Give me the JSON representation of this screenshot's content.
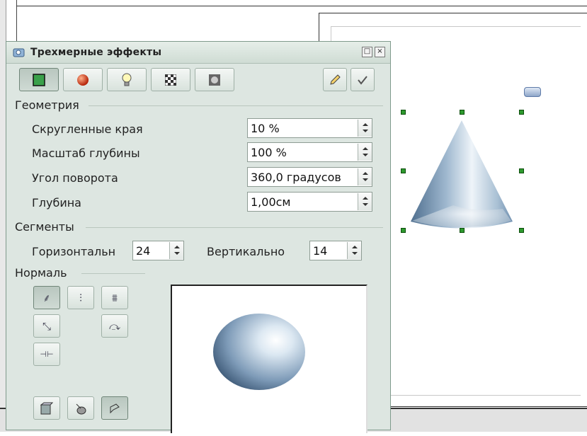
{
  "dialog": {
    "title": "Трехмерные эффекты",
    "title_icon": "3d-effects-icon",
    "controls": {
      "restore": "□",
      "close": "×"
    }
  },
  "toolbar": {
    "tools": [
      {
        "name": "geometry",
        "icon": "geometry-icon",
        "pressed": true
      },
      {
        "name": "shading",
        "icon": "shading-icon",
        "pressed": false
      },
      {
        "name": "illumination",
        "icon": "lightbulb-icon",
        "pressed": false
      },
      {
        "name": "textures",
        "icon": "texture-icon",
        "pressed": false
      },
      {
        "name": "material",
        "icon": "material-icon",
        "pressed": false
      }
    ],
    "right": [
      {
        "name": "assign",
        "icon": "pencil-icon",
        "pressed": true
      },
      {
        "name": "update",
        "icon": "checkmark-icon",
        "pressed": false
      }
    ]
  },
  "geometry": {
    "section_label": "Геометрия",
    "fields": [
      {
        "label": "Скругленные края",
        "value": "10 %"
      },
      {
        "label": "Масштаб глубины",
        "value": "100 %"
      },
      {
        "label": "Угол поворота",
        "value": "360,0 градусов"
      },
      {
        "label": "Глубина",
        "value": "1,00см"
      }
    ]
  },
  "segments": {
    "section_label": "Сегменты",
    "horizontal_label": "Горизонтальн",
    "horizontal_value": "24",
    "vertical_label": "Вертикально",
    "vertical_value": "14"
  },
  "normals": {
    "section_label": "Нормаль",
    "buttons": [
      {
        "name": "object-specific",
        "icon": "object-normals-icon",
        "glyph": "⸙"
      },
      {
        "name": "flat",
        "icon": "flat-normals-icon",
        "glyph": "⫶"
      },
      {
        "name": "spherical",
        "icon": "spherical-normals-icon",
        "glyph": "⩩"
      },
      {
        "name": "invert",
        "icon": "invert-normals-icon",
        "glyph": "⤡"
      },
      {
        "name": "double-sided-lighting",
        "icon": "double-sided-lighting-icon",
        "glyph": "⤼"
      },
      {
        "name": "double-sided",
        "icon": "double-sided-icon",
        "glyph": "⊣⊢"
      }
    ],
    "bottom_buttons": [
      {
        "name": "convert-to-3d",
        "icon": "convert-3d-icon"
      },
      {
        "name": "convert-to-lathe",
        "icon": "lathe-object-icon"
      },
      {
        "name": "perspective",
        "icon": "perspective-icon"
      }
    ]
  },
  "colors": {
    "dialog_bg": "#dde6e1",
    "handle": "#2e9a2e",
    "cone_light": "#f2f7fb",
    "cone_dark": "#5f7fa0"
  }
}
